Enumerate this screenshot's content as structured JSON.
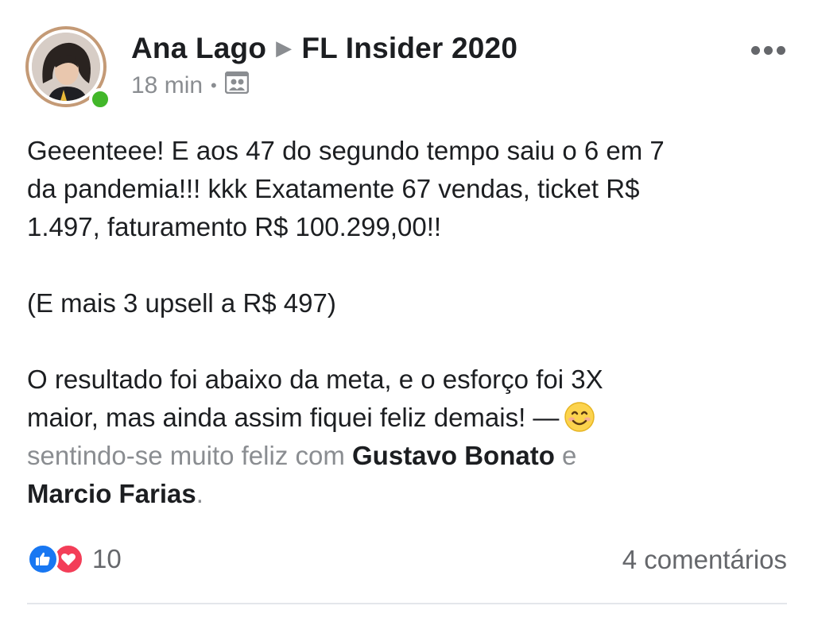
{
  "post": {
    "author": "Ana Lago",
    "group": "FL Insider 2020",
    "time": "18 min",
    "text_lines_1": [
      "Geeenteee! E aos 47 do segundo tempo saiu o 6 em 7",
      "da pandemia!!! kkk Exatamente 67 vendas, ticket R$",
      "1.497, faturamento R$ 100.299,00!!"
    ],
    "text_line_2": "(E mais 3 upsell a R$ 497)",
    "text_lines_3": [
      "O resultado foi abaixo da meta, e o esforço foi 3X",
      "maior, mas ainda assim fiquei feliz demais! —"
    ],
    "feeling": "sentindo-se muito feliz com",
    "tagged_1": "Gustavo Bonato",
    "conj": "e",
    "tagged_2": "Marcio Farias",
    "end": "."
  },
  "stats": {
    "reaction_count": "10",
    "comments": "4 comentários"
  },
  "colors": {
    "online": "#42b72a",
    "like": "#1877f2",
    "love": "#f33e58"
  },
  "icons": [
    "audience-group-icon",
    "more-icon",
    "like-reaction-icon",
    "love-reaction-icon",
    "smile-emoji-icon"
  ]
}
